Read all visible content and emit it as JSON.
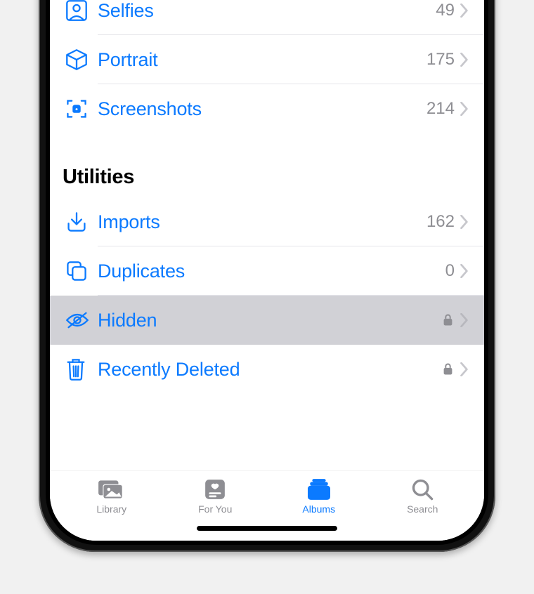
{
  "section1": {
    "rows": [
      {
        "label": "Selfies",
        "count": "49"
      },
      {
        "label": "Portrait",
        "count": "175"
      },
      {
        "label": "Screenshots",
        "count": "214"
      }
    ]
  },
  "utilities": {
    "header": "Utilities",
    "rows": [
      {
        "label": "Imports",
        "count": "162"
      },
      {
        "label": "Duplicates",
        "count": "0"
      },
      {
        "label": "Hidden"
      },
      {
        "label": "Recently Deleted"
      }
    ]
  },
  "tabs": {
    "library": "Library",
    "for_you": "For You",
    "albums": "Albums",
    "search": "Search"
  }
}
